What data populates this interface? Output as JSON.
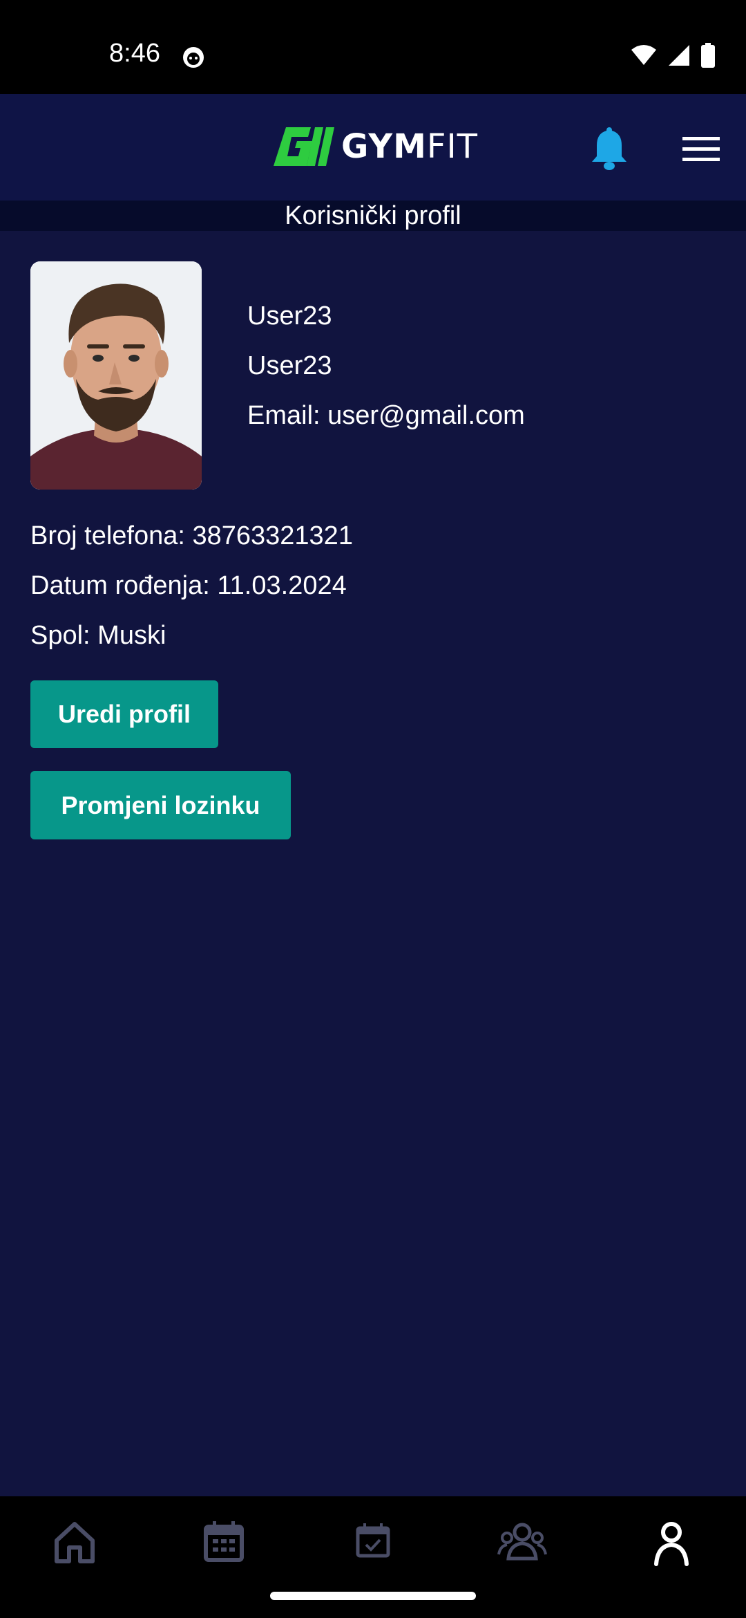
{
  "status_bar": {
    "time": "8:46"
  },
  "header": {
    "logo_primary": "GYM",
    "logo_secondary": "FIT",
    "accent_color": "#2ecc40",
    "bell_color": "#1ea7e6",
    "icons": [
      "bell-icon",
      "hamburger-menu-icon"
    ]
  },
  "page": {
    "title": "Korisnički profil"
  },
  "profile": {
    "first_name": "User23",
    "last_name": "User23",
    "email": "Email: user@gmail.com",
    "phone": "Broj telefona: 38763321321",
    "birth_date": "Datum rođenja: 11.03.2024",
    "gender": "Spol: Muski"
  },
  "actions": {
    "edit_profile": "Uredi profil",
    "change_password": "Promjeni lozinku",
    "button_color": "#07978a"
  },
  "bottom_nav": {
    "items": [
      "home-icon",
      "calendar-icon",
      "calendar-check-icon",
      "group-icon",
      "profile-icon"
    ],
    "active": "profile-icon"
  }
}
